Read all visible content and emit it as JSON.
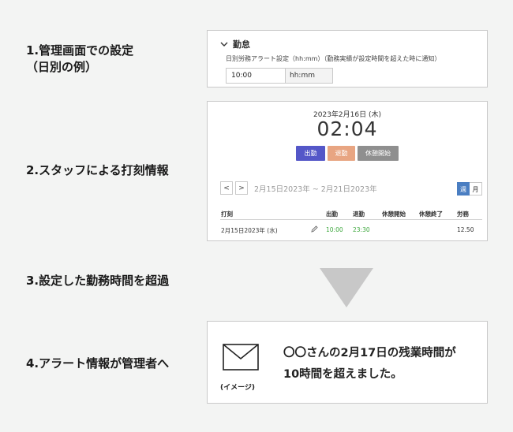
{
  "steps": {
    "s1_line1": "1.管理画面での設定",
    "s1_line2": "（日別の例）",
    "s2": "2.スタッフによる打刻情報",
    "s3": "3.設定した勤務時間を超過",
    "s4": "4.アラート情報が管理者へ"
  },
  "settings": {
    "section": "勤怠",
    "description": "日別労務アラート設定（hh:mm）（勤務実績が設定時間を超えた時に通知）",
    "value": "10:00",
    "unit": "hh:mm"
  },
  "clock": {
    "date": "2023年2月16日 (木)",
    "time": "02:04",
    "btn_in": "出勤",
    "btn_out": "退勤",
    "btn_break": "休憩開始",
    "prev": "<",
    "next": ">",
    "range": "2月15日2023年 ~ 2月21日2023年",
    "toggle_week": "週",
    "toggle_month": "月"
  },
  "table": {
    "headers": [
      "打刻",
      "出勤",
      "退勤",
      "休憩開始",
      "休憩終了",
      "労務"
    ],
    "row": {
      "date": "2月15日2023年 (水)",
      "in": "10:00",
      "out": "23:30",
      "break_start": "",
      "break_end": "",
      "work": "12.50"
    }
  },
  "alert": {
    "image_caption": "(イメージ)",
    "message_line1": "〇〇さんの2月17日の残業時間が",
    "message_line2": "10時間を超えました。"
  },
  "colors": {
    "background": "#f3f4f3",
    "clock_in": "#5457c8",
    "clock_out": "#e8a582",
    "break": "#8f8f8f",
    "toggle_active": "#4a7ec2",
    "time_green": "#3ea83e",
    "triangle": "#c8c8c8"
  },
  "icons": [
    "chevron-down-icon",
    "pencil-icon",
    "envelope-icon",
    "triangle-down-icon"
  ]
}
